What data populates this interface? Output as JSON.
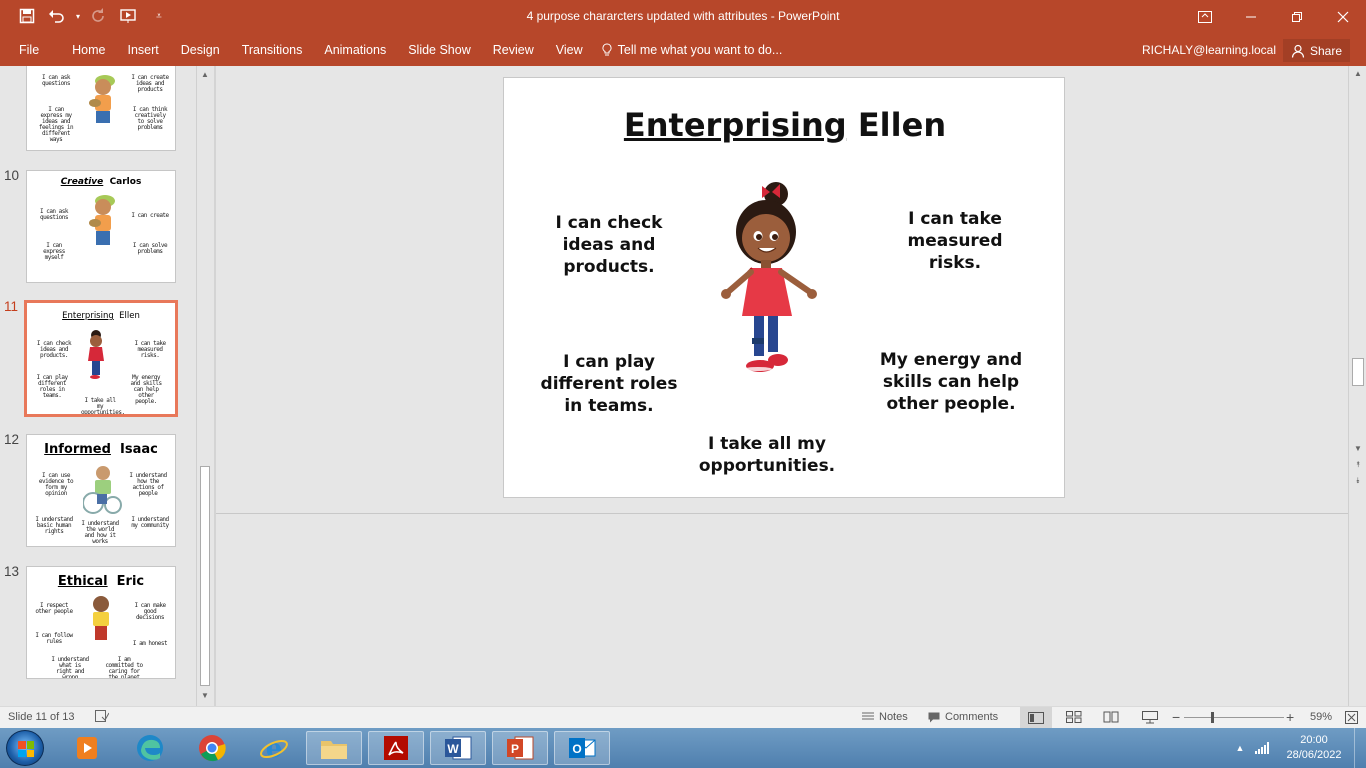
{
  "window": {
    "title": "4 purpose chararcters updated with attributes - PowerPoint",
    "accent_color": "#b7472a"
  },
  "quick_access": {
    "icons": [
      "save-icon",
      "undo-icon",
      "redo-icon",
      "start-from-beginning-icon",
      "customize-qat-icon"
    ]
  },
  "ribbon": {
    "tabs": [
      "File",
      "Home",
      "Insert",
      "Design",
      "Transitions",
      "Animations",
      "Slide Show",
      "Review",
      "View"
    ],
    "tell_me": "Tell me what you want to do...",
    "account": "RICHALY@learning.local",
    "share": "Share"
  },
  "thumbnails": [
    {
      "number": "",
      "title_left": "",
      "title_right": "",
      "texts": [
        "I can ask questions",
        "I can create ideas and products",
        "I can express my ideas and feelings in different ways",
        "I can think creatively to solve problems"
      ]
    },
    {
      "number": "10",
      "title_left": "Creative",
      "title_right": "Carlos",
      "texts": [
        "I can ask questions",
        "I can create",
        "I can express myself",
        "I can solve problems"
      ]
    },
    {
      "number": "11",
      "title_left": "Enterprising",
      "title_right": "Ellen",
      "texts": [
        "I can check ideas and products.",
        "I can take measured risks.",
        "I can play different roles in teams.",
        "My energy and skills can help other people.",
        "I take all my opportunities."
      ]
    },
    {
      "number": "12",
      "title_left": "Informed",
      "title_right": "Isaac",
      "texts": [
        "I can use evidence to form my opinion",
        "I understand how the actions of people",
        "I understand basic human rights",
        "I understand the world and how it works",
        "I understand my community"
      ]
    },
    {
      "number": "13",
      "title_left": "Ethical",
      "title_right": "Eric",
      "texts": [
        "I respect other people",
        "I can make good decisions",
        "I can follow rules",
        "I am honest",
        "I understand what is right and wrong",
        "I am committed to caring for the planet"
      ]
    }
  ],
  "slide": {
    "title_underlined": "Enterprising",
    "title_rest": "Ellen",
    "top_left": "I can check ideas and products.",
    "top_right": "I can take measured risks.",
    "mid_left": "I can play different roles in teams.",
    "mid_right": "My energy and skills can help other people.",
    "bottom": "I take all my opportunities."
  },
  "status": {
    "slide_info": "Slide 11 of 13",
    "notes": "Notes",
    "comments": "Comments",
    "zoom": "59%"
  },
  "taskbar": {
    "apps": [
      "windows-media-player",
      "microsoft-edge",
      "google-chrome",
      "internet-explorer",
      "file-explorer",
      "adobe-acrobat",
      "microsoft-word",
      "microsoft-powerpoint",
      "microsoft-outlook"
    ],
    "time": "20:00",
    "date": "28/06/2022"
  }
}
